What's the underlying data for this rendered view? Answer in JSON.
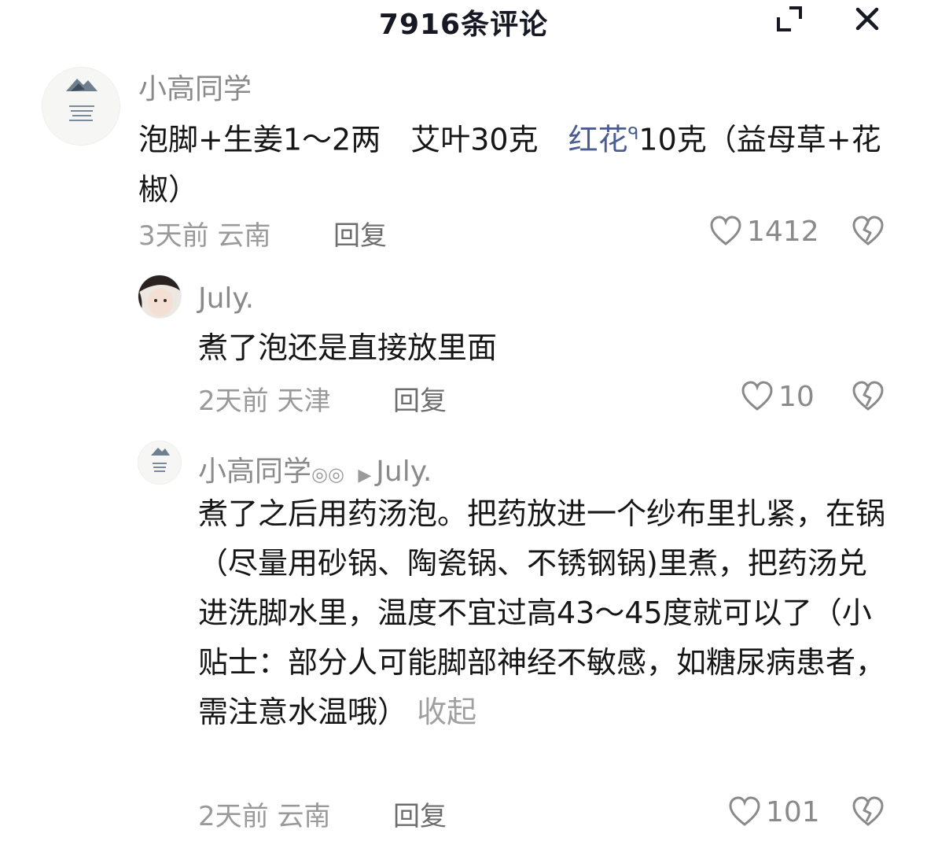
{
  "header": {
    "title": "7916条评论",
    "expand_icon": "expand-icon",
    "close_icon": "close-icon"
  },
  "comments": [
    {
      "username": "小高同学",
      "text_before": "泡脚+生姜1～2两　艾叶30克　",
      "highlight": "红花",
      "text_after": "10克（益母草+花椒）",
      "time": "3天前",
      "location": "云南",
      "reply": "回复",
      "likes": "1412"
    },
    {
      "username": "July.",
      "text": "煮了泡还是直接放里面",
      "time": "2天前",
      "location": "天津",
      "reply": "回复",
      "likes": "10"
    },
    {
      "username": "小高同学",
      "username_suffix": "◎◎",
      "reply_to": "July.",
      "text": "煮了之后用药汤泡。把药放进一个纱布里扎紧，在锅（尽量用砂锅、陶瓷锅、不锈钢锅)里煮，把药汤兑进洗脚水里，温度不宜过高43～45度就可以了（小贴士：部分人可能脚部神经不敏感，如糖尿病患者，需注意水温哦）",
      "collapse": "收起",
      "time": "2天前",
      "location": "云南",
      "reply": "回复",
      "likes": "101"
    }
  ],
  "colors": {
    "highlight": "#4a5d8f",
    "muted": "#9a9a9a",
    "text": "#161616"
  }
}
